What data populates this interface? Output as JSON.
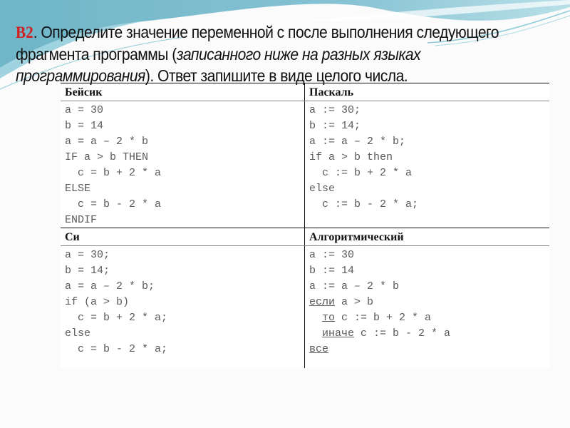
{
  "title": {
    "label": "В2",
    "text_before_italic": ". Определите значение переменной с после выполнения следующего фрагмента программы (",
    "italic_text": "записанного ниже на разных языках программирования",
    "text_after_italic": "). Ответ запишите в виде целого числа."
  },
  "table": {
    "basic": {
      "header": "Бейсик",
      "lines": [
        "a = 30",
        "b = 14",
        "a = a – 2 * b",
        "IF a > b THEN",
        "  c = b + 2 * a",
        "ELSE",
        "  c = b - 2 * a",
        "ENDIF"
      ]
    },
    "pascal": {
      "header": "Паскаль",
      "lines": [
        "a := 30;",
        "b := 14;",
        "a := a – 2 * b;",
        "if a > b then",
        "  c := b + 2 * a",
        "else",
        "  c := b - 2 * a;"
      ]
    },
    "c": {
      "header": "Си",
      "lines": [
        "a = 30;",
        "b = 14;",
        "a = a – 2 * b;",
        "if (a > b)",
        "  c = b + 2 * a;",
        "else",
        "  c = b - 2 * a;"
      ]
    },
    "algorithmic": {
      "header": "Алгоритмический",
      "lines": [
        {
          "kw": "",
          "text": "a := 30"
        },
        {
          "kw": "",
          "text": "b := 14"
        },
        {
          "kw": "",
          "text": "a := a – 2 * b"
        },
        {
          "kw": "если",
          "text": " a > b",
          "indent": ""
        },
        {
          "kw": "то",
          "text": " c := b + 2 * a",
          "indent": "  "
        },
        {
          "kw": "иначе",
          "text": " c := b - 2 * a",
          "indent": "  "
        },
        {
          "kw": "все",
          "text": "",
          "indent": ""
        }
      ]
    }
  },
  "colors": {
    "label_red": "#d01f1f",
    "wave_blue": "#6fb3c9"
  }
}
